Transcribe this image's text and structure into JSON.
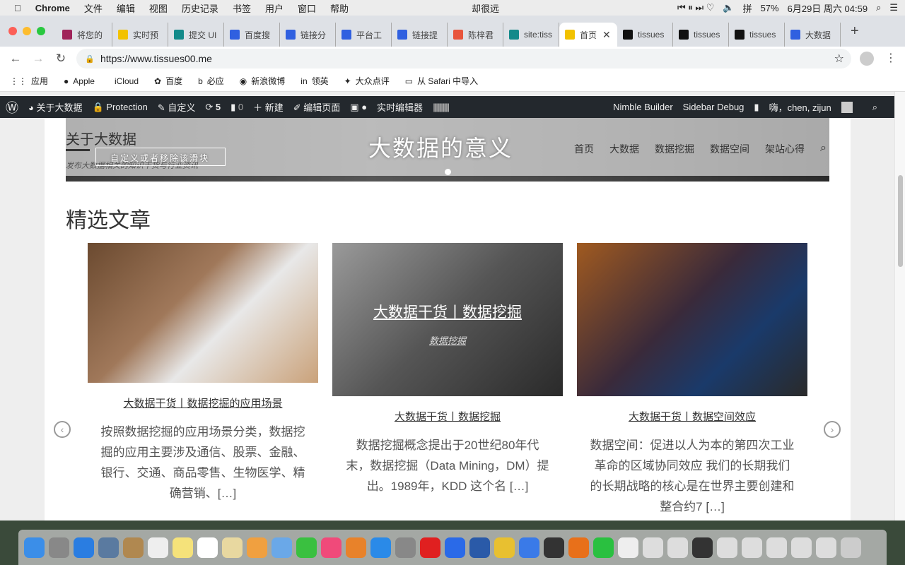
{
  "menubar": {
    "apple": "",
    "app": "Chrome",
    "items": [
      "文件",
      "编辑",
      "视图",
      "历史记录",
      "书签",
      "用户",
      "窗口",
      "帮助"
    ],
    "now_playing": "却很远",
    "battery": "57%",
    "datetime": "6月29日 周六  04:59",
    "input_method": "拼"
  },
  "tabs": [
    {
      "label": "将您的",
      "color": "#a0245a"
    },
    {
      "label": "实时预",
      "color": "#f2c200"
    },
    {
      "label": "提交 UI",
      "color": "#138a8a"
    },
    {
      "label": "百度搜",
      "color": "#3060e0"
    },
    {
      "label": "链接分",
      "color": "#3060e0"
    },
    {
      "label": "平台工",
      "color": "#3060e0"
    },
    {
      "label": "链接提",
      "color": "#3060e0"
    },
    {
      "label": "陈梓君",
      "color": "#e8553c"
    },
    {
      "label": "site:tiss",
      "color": "#138a8a"
    },
    {
      "label": "首页",
      "color": "#f2c200",
      "active": true
    },
    {
      "label": "tissues",
      "color": "#111"
    },
    {
      "label": "tissues",
      "color": "#111"
    },
    {
      "label": "tissues",
      "color": "#111"
    },
    {
      "label": "大数据",
      "color": "#3060e0"
    }
  ],
  "address": {
    "url": "https://www.tissues00.me"
  },
  "bookmarks": [
    "应用",
    "Apple",
    "iCloud",
    "百度",
    "必应",
    "新浪微博",
    "领英",
    "大众点评",
    "从 Safari 中导入"
  ],
  "wpbar": {
    "items": [
      "关于大数据",
      "Protection",
      "自定义",
      "5",
      "0",
      "新建",
      "编辑页面",
      "实时编辑器"
    ],
    "right": [
      "Nimble Builder",
      "Sidebar Debug",
      "嗨，chen, zijun"
    ]
  },
  "site": {
    "title": "关于大数据",
    "tagline": "发布大数据相关的知识干货与行业资讯",
    "hero_title": "大数据的意义",
    "slider_button": "自定义或者移除该滑块",
    "nav": [
      "首页",
      "大数据",
      "数据挖掘",
      "数据空间",
      "架站心得"
    ]
  },
  "featured": {
    "title": "精选文章",
    "cards": [
      {
        "title": "大数据干货丨数据挖掘的应用场景",
        "excerpt": "按照数据挖掘的应用场景分类，数据挖掘的应用主要涉及通信、股票、金融、银行、交通、商品零售、生物医学、精确营销、[…]"
      },
      {
        "title": "大数据干货丨数据挖掘",
        "excerpt": "数据挖掘概念提出于20世纪80年代末，数据挖掘（Data Mining，DM）提出。1989年，KDD 这个名 […]",
        "overlay_title": "大数据干货丨数据挖掘",
        "overlay_category": "数据挖掘"
      },
      {
        "title": "大数据干货丨数据空间效应",
        "excerpt": "数据空间：促进以人为本的第四次工业革命的区域协同效应 我们的长期我们的长期战略的核心是在世界主要创建和整合约7 […]"
      }
    ]
  },
  "colors": {
    "wpbar": "#23282d",
    "tabstrip": "#dee1e6"
  }
}
